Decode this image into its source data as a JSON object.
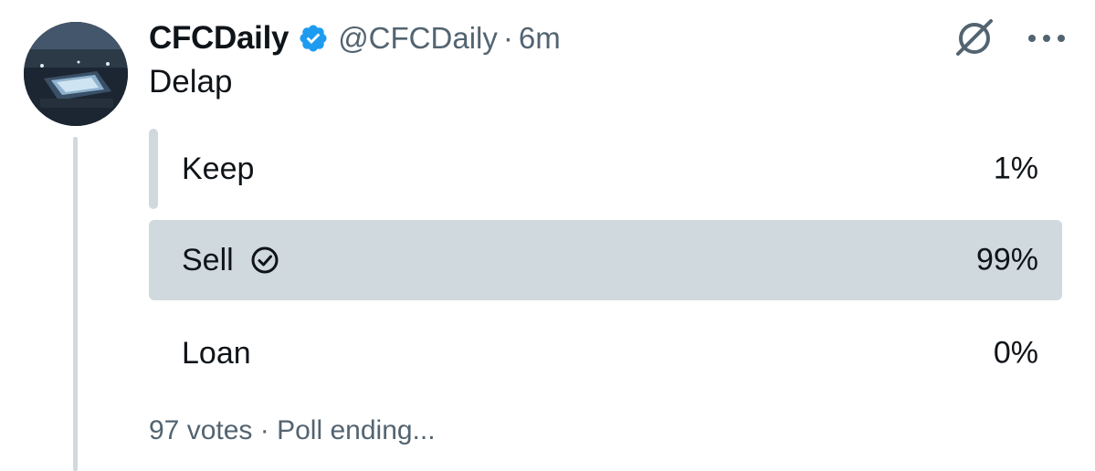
{
  "tweet": {
    "display_name": "CFCDaily",
    "handle": "@CFCDaily",
    "separator": "·",
    "time": "6m",
    "verified_icon": "verified-badge-icon",
    "text": "Delap"
  },
  "actions": {
    "grok_icon": "grok-icon",
    "more_icon": "more-options-icon"
  },
  "poll": {
    "options": [
      {
        "label": "Keep",
        "percent_text": "1%",
        "share": 0.01,
        "winner": false
      },
      {
        "label": "Sell",
        "percent_text": "99%",
        "share": 0.99,
        "winner": true
      },
      {
        "label": "Loan",
        "percent_text": "0%",
        "share": 0.0,
        "winner": false
      }
    ],
    "votes": "97 votes",
    "separator": "·",
    "status": "Poll ending..."
  },
  "colors": {
    "bar": "#cfd9de",
    "verified": "#1d9bf0",
    "secondary_text": "#536471"
  }
}
